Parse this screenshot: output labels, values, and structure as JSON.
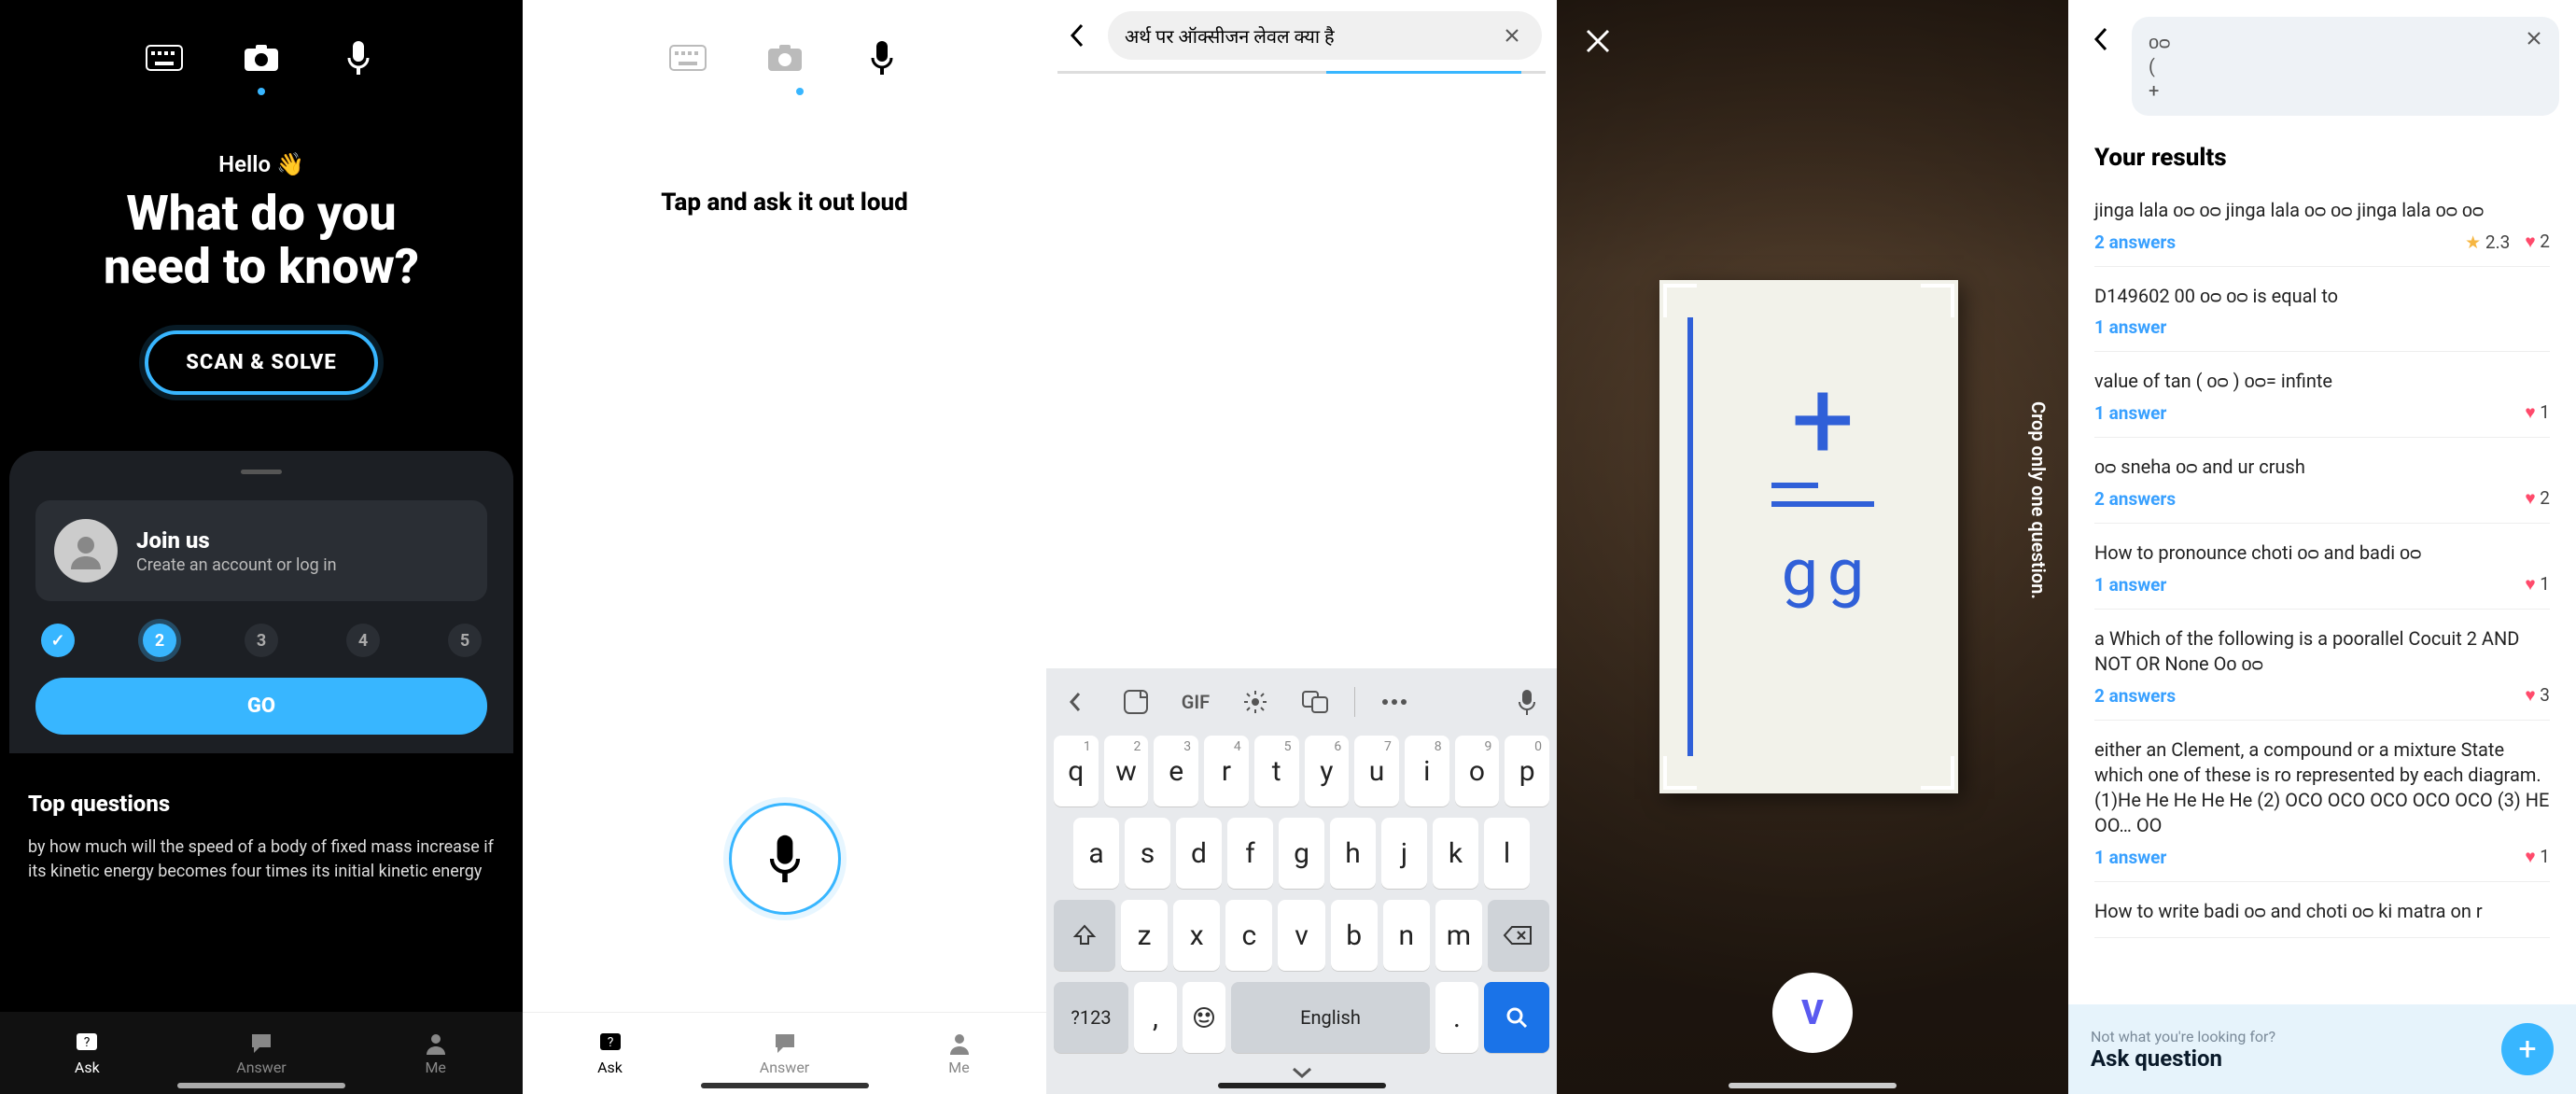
{
  "screen1": {
    "hello": "Hello 👋",
    "headline1": "What do you",
    "headline2": "need to know?",
    "scan_btn": "SCAN & SOLVE",
    "join_title": "Join us",
    "join_sub": "Create an account or log in",
    "steps": [
      "✓",
      "2",
      "3",
      "4",
      "5"
    ],
    "go": "GO",
    "top_questions_heading": "Top questions",
    "top_question_1": "by how much will the speed of a body of fixed mass increase if its kinetic energy becomes four times its initial kinetic energy",
    "nav": {
      "ask": "Ask",
      "answer": "Answer",
      "me": "Me"
    }
  },
  "screen2": {
    "prompt": "Tap and ask it out loud",
    "nav": {
      "ask": "Ask",
      "answer": "Answer",
      "me": "Me"
    }
  },
  "screen3": {
    "search_value": "अर्थ पर ऑक्सीजन लेवल क्या है",
    "keyboard": {
      "gif": "GIF",
      "row1": [
        {
          "k": "q",
          "n": "1"
        },
        {
          "k": "w",
          "n": "2"
        },
        {
          "k": "e",
          "n": "3"
        },
        {
          "k": "r",
          "n": "4"
        },
        {
          "k": "t",
          "n": "5"
        },
        {
          "k": "y",
          "n": "6"
        },
        {
          "k": "u",
          "n": "7"
        },
        {
          "k": "i",
          "n": "8"
        },
        {
          "k": "o",
          "n": "9"
        },
        {
          "k": "p",
          "n": "0"
        }
      ],
      "row2": [
        "a",
        "s",
        "d",
        "f",
        "g",
        "h",
        "j",
        "k",
        "l"
      ],
      "row3": [
        "z",
        "x",
        "c",
        "v",
        "b",
        "n",
        "m"
      ],
      "sym": "?123",
      "comma": ",",
      "space": "English",
      "dot": "."
    }
  },
  "screen4": {
    "hint": "Crop only one question.",
    "shutter": "V"
  },
  "screen5": {
    "query_line1": "ᴏᴑ",
    "query_line2": "(",
    "query_line3": "+",
    "heading": "Your results",
    "items": [
      {
        "title": "jinga lala ᴏᴑ ᴏᴑ jinga lala ᴏᴑ ᴏᴑ jinga lala ᴏᴑ ᴏᴑ",
        "answers": "2 answers",
        "rating": "2.3",
        "hearts": "2",
        "show_rating": true
      },
      {
        "title": "D149602 00 ᴏᴑ ᴏᴑ is equal to",
        "answers": "1 answer",
        "hearts": null
      },
      {
        "title": "value of tan ( ᴏᴑ ) ᴏᴑ= infinte",
        "answers": "1 answer",
        "hearts": "1"
      },
      {
        "title": "ᴏᴑ sneha ᴏᴑ and ur crush",
        "answers": "2 answers",
        "hearts": "2"
      },
      {
        "title": "How to pronounce choti ᴏᴑ and badi ᴏᴑ",
        "answers": "1 answer",
        "hearts": "1"
      },
      {
        "title": "a Which of the following is a poorallel Cocuit 2 AND NOT OR None Oᴏ ᴏᴑ",
        "answers": "2 answers",
        "hearts": "3"
      },
      {
        "title": "either an Clement, a compound or a mixture State which one of these is ro represented by each diagram. (1)He He He He He (2) OCO OCO OCO OCO OCO (3) HE OO… OO",
        "answers": "1 answer",
        "hearts": "1"
      },
      {
        "title": "How to write badi ᴏᴑ and choti ᴏᴑ ki matra on r",
        "answers": null,
        "hearts": null
      }
    ],
    "ask_hint": "Not what you're looking for?",
    "ask_label": "Ask question"
  }
}
